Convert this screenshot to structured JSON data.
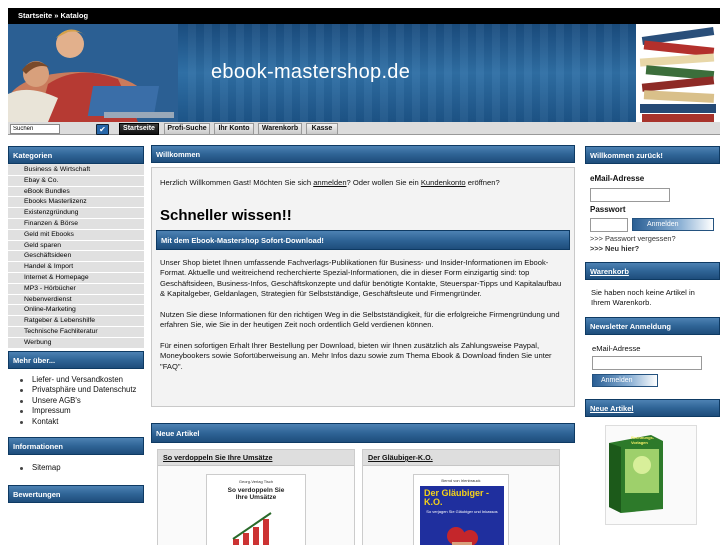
{
  "breadcrumb": "Startseite » Katalog",
  "site_title": "ebook-mastershop.de",
  "search": {
    "value": "Suchen"
  },
  "nav": [
    "Startseite",
    "Profi-Suche",
    "Ihr Konto",
    "Warenkorb",
    "Kasse"
  ],
  "left": {
    "kategorien_title": "Kategorien",
    "kategorien": [
      "Business & Wirtschaft",
      "Ebay & Co.",
      "eBook Bundles",
      "Ebooks Masterlizenz",
      "Existenzgründung",
      "Finanzen & Börse",
      "Geld mit Ebooks",
      "Geld sparen",
      "Geschäftsideen",
      "Handel & Import",
      "Internet & Homepage",
      "MP3 - Hörbücher",
      "Nebenverdienst",
      "Online-Marketing",
      "Ratgeber & Lebenshilfe",
      "Technische Fachliteratur",
      "Werbung"
    ],
    "mehr_title": "Mehr über...",
    "mehr": [
      "Liefer- und Versandkosten",
      "Privatsphäre und Datenschutz",
      "Unsere AGB's",
      "Impressum",
      "Kontakt"
    ],
    "info_title": "Informationen",
    "info": [
      "Sitemap"
    ],
    "bewertungen_title": "Bewertungen"
  },
  "main": {
    "welcome_title": "Willkommen",
    "welcome_pre": "Herzlich Willkommen Gast! Möchten Sie sich ",
    "welcome_link1": "anmelden",
    "welcome_mid": "? Oder wollen Sie ein ",
    "welcome_link2": "Kundenkonto",
    "welcome_post": " eröffnen?",
    "headline": "Schneller wissen!!",
    "download_title": "Mit dem Ebook-Mastershop Sofort-Download!",
    "para1": "Unser Shop bietet Ihnen umfassende Fachverlags-Publikationen für Business- und Insider-Informationen im Ebook-Format. Aktuelle und weitreichend recherchierte Spezial-Informationen, die in dieser Form einzigartig sind: top Geschäftsideen, Business-Infos, Geschäftskonzepte und dafür benötigte Kontakte, Steuerspar-Tipps und Kapitalaufbau & Kapitalgeber, Geldanlagen, Strategien für Selbstständige, Geschäftsleute und Firmengründer.",
    "para2": "Nutzen Sie diese Informationen für den richtigen Weg in die Selbstständigkeit, für die erfolgreiche Firmengründung und erfahren Sie, wie Sie in der heutigen Zeit noch ordentlich Geld verdienen können.",
    "para3": "Für einen sofortigen Erhalt Ihrer Bestellung per Download, bieten wir Ihnen zusätzlich als Zahlungsweise Paypal, Moneybookers sowie Sofortüberweisung an. Mehr Infos dazu sowie zum Thema Ebook & Download finden Sie unter \"FAQ\".",
    "neue_title": "Neue Artikel",
    "products": [
      {
        "name": "So verdoppeln Sie Ihre Umsätze",
        "cover_title": "So verdoppeln Sie Ihre Umsätze",
        "cover_top": "Georg-Verlag Tisch"
      },
      {
        "name": "Der Gläubiger-K.O.",
        "cover_title": "Der Gläubiger - K.O.",
        "cover_top": "Bernd von Irlenbrauck",
        "cover_sub": "So verjagen Sie Gläubiger und Inkassos"
      }
    ]
  },
  "right": {
    "welcome_back_title": "Willkommen zurück!",
    "email_label": "eMail-Adresse",
    "password_label": "Passwort",
    "login_button": "Anmelden",
    "forgot": ">>> Passwort vergessen?",
    "new_here": ">>> Neu hier?",
    "cart_title": "Warenkorb",
    "cart_text": "Sie haben noch keine Artikel in Ihrem Warenkorb.",
    "newsletter_title": "Newsletter Anmeldung",
    "newsletter_label": "eMail-Adresse",
    "newsletter_button": "Anmelden",
    "neue_title": "Neue Artikel",
    "product_cover_title": "Rechnungs-Vorlagen"
  }
}
